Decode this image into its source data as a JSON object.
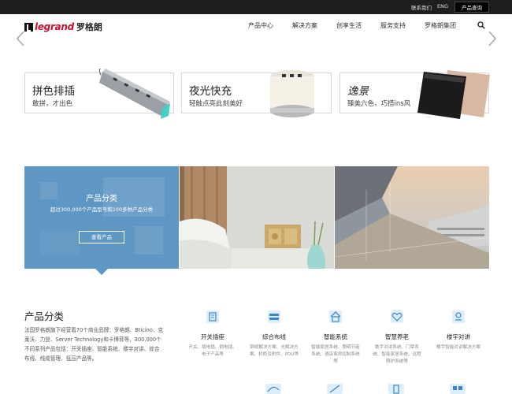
{
  "topbar": {
    "contact": "联系我们",
    "lang": "ENG",
    "query": "产品查询"
  },
  "logo": {
    "brand": "legrand",
    "cn": "罗格朗"
  },
  "nav": [
    "产品中心",
    "解决方案",
    "创享生活",
    "服务支持",
    "罗格朗集团"
  ],
  "promos": [
    {
      "t1": "拼色排插",
      "t2": "敢拼，才出色"
    },
    {
      "t1": "夜光快充",
      "t2": "轻触点亮此刻美好"
    },
    {
      "t1": "逸景",
      "t2": "臻美六色，巧搭ins风"
    }
  ],
  "feature": {
    "title": "产品分类",
    "subtitle": "超过300,000个产品型号和100多种产品分类",
    "button": "查看产品"
  },
  "section": {
    "title": "产品分类",
    "desc": "法国罗格朗旗下经营着70个商业品牌：罗格朗、Bticino、克莱沃、力登、Server Technology和卡博菲等，300,000个不同系列产品包括：开关插座、智能系统、楼宇对讲、综合布线、线缆管理、低压产品等。"
  },
  "categories": [
    {
      "name": "开关插座",
      "desc": "开关、插电插、弱电插、电子产品等"
    },
    {
      "name": "综合布线",
      "desc": "铜缆解决方案、光解决方案、机柜及附件、PDU等"
    },
    {
      "name": "智能系统",
      "desc": "智能家居系统、照明节能系统、酒店客房控制系统等"
    },
    {
      "name": "智慧养老",
      "desc": "数字对讲系统、门禁系统、智能家居系统、远程照护系统等"
    },
    {
      "name": "楼宇对讲",
      "desc": "楼宇智能对讲解决方案"
    }
  ],
  "colors": {
    "accent": "#c8102e",
    "feature_blue": "#5f97c4",
    "topbar": "#1e1e1e"
  }
}
